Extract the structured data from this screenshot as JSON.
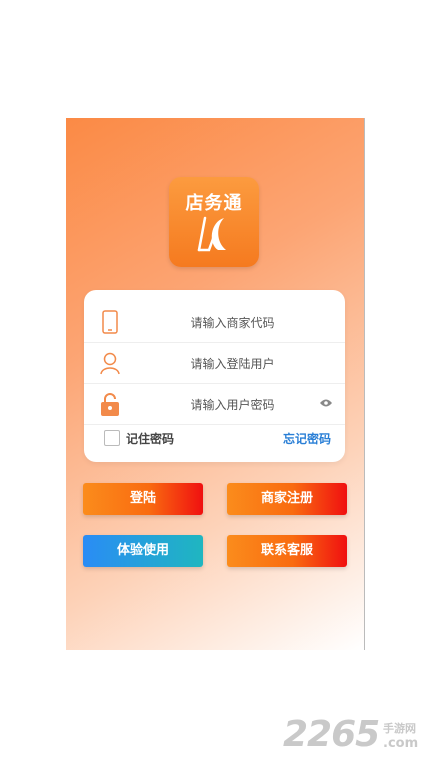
{
  "app": {
    "logo_text": "店务通"
  },
  "form": {
    "merchant_code_placeholder": "请输入商家代码",
    "username_placeholder": "请输入登陆用户",
    "password_placeholder": "请输入用户密码",
    "remember_label": "记住密码",
    "forgot_label": "忘记密码"
  },
  "buttons": {
    "login": "登陆",
    "register": "商家注册",
    "trial": "体验使用",
    "contact": "联系客服"
  },
  "watermark": {
    "number": "2265",
    "site": "手游网",
    "domain": ".com"
  },
  "colors": {
    "brand_orange": "#f97b1c",
    "link_blue": "#2a7fd6"
  }
}
